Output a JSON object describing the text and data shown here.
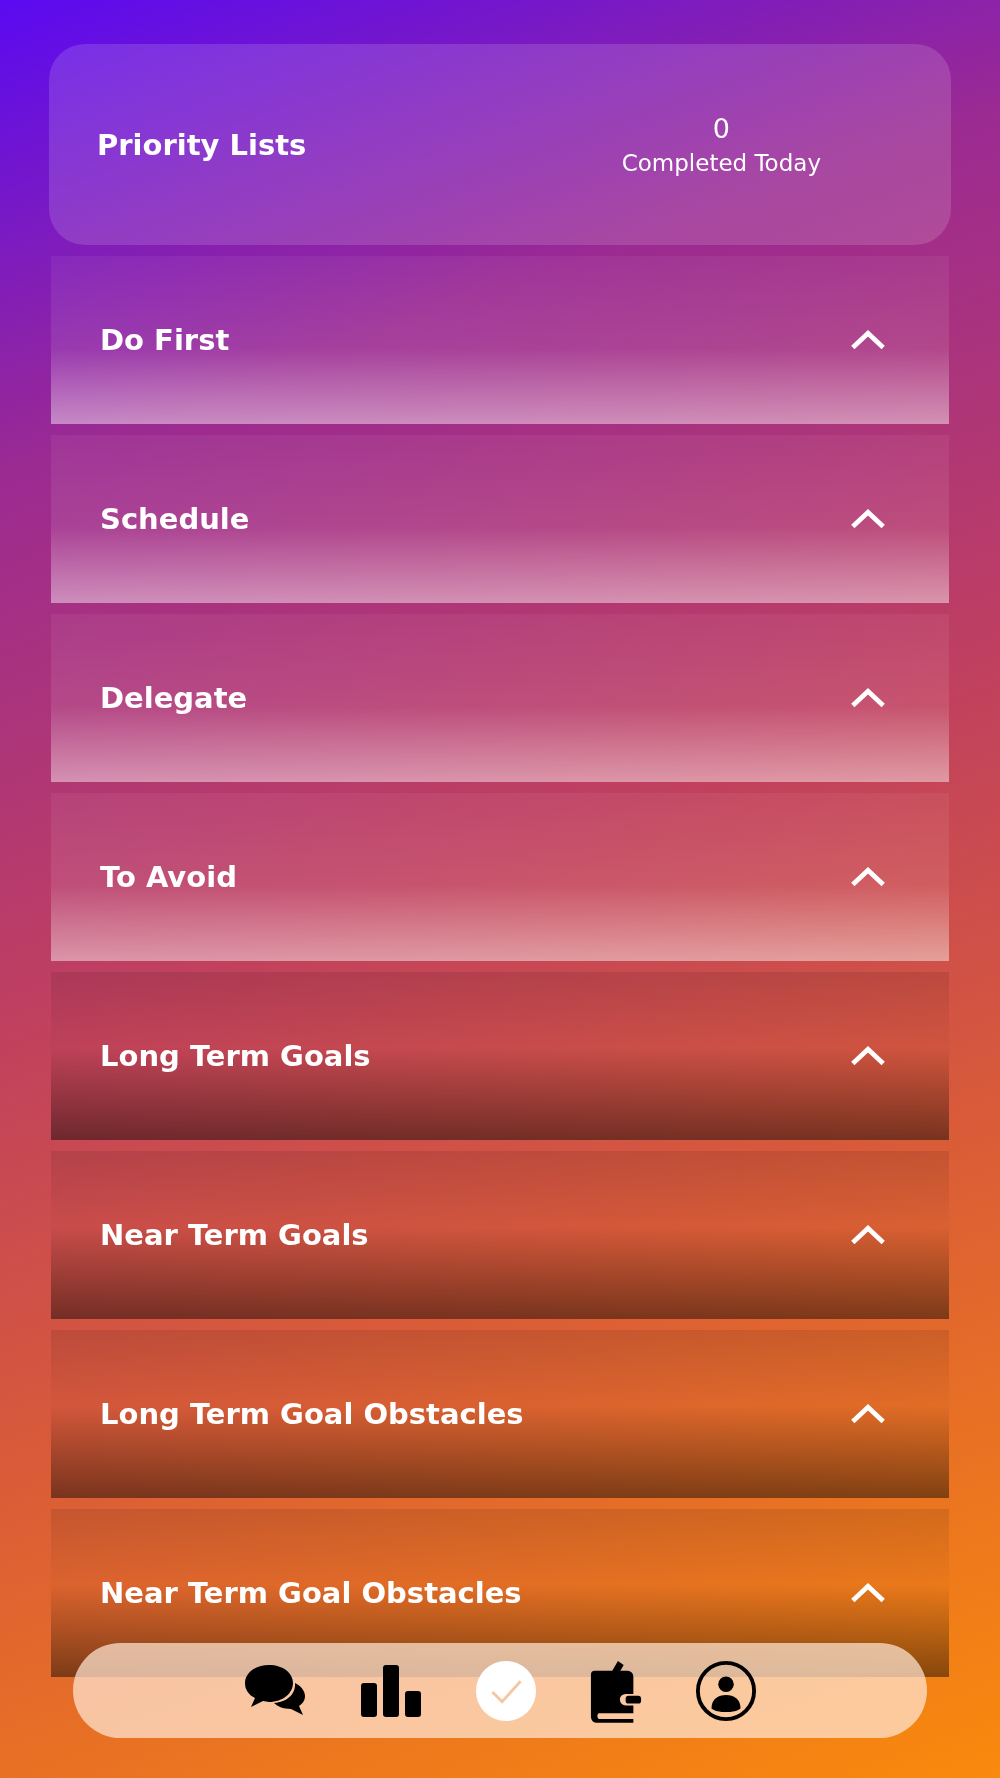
{
  "header": {
    "title": "Priority Lists",
    "count": "0",
    "count_label": "Completed Today"
  },
  "lists": [
    {
      "name": "Do First",
      "kind": "light",
      "expanded": true
    },
    {
      "name": "Schedule",
      "kind": "light",
      "expanded": true
    },
    {
      "name": "Delegate",
      "kind": "light",
      "expanded": true
    },
    {
      "name": "To Avoid",
      "kind": "light",
      "expanded": true
    },
    {
      "name": "Long Term Goals",
      "kind": "dark",
      "expanded": true
    },
    {
      "name": "Near Term Goals",
      "kind": "dark",
      "expanded": true
    },
    {
      "name": "Long Term Goal Obstacles",
      "kind": "dark",
      "expanded": true
    },
    {
      "name": "Near Term Goal Obstacles",
      "kind": "dark",
      "expanded": true
    }
  ],
  "tab_bar": [
    {
      "kind": "chat",
      "selected": false
    },
    {
      "kind": "chart",
      "selected": false
    },
    {
      "kind": "check",
      "selected": true
    },
    {
      "kind": "journal",
      "selected": false
    },
    {
      "kind": "profile",
      "selected": false
    }
  ]
}
